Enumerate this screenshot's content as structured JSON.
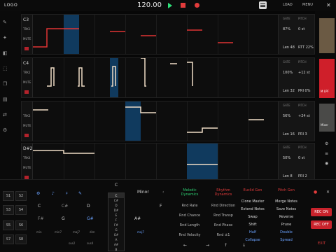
{
  "topbar": {
    "logo": "LOGO",
    "tempo": "120.00",
    "tab_1": "LOAD",
    "tab_2": "MENU"
  },
  "tracks": [
    {
      "note": "C3",
      "label_top": "TRK1",
      "label_mid": "MUTE",
      "param_1": "87%",
      "param_1_label": "GATE",
      "param_2": "0 st",
      "param_2_label": "PITCH",
      "param_3": "Len 48",
      "param_4": "RTT 22%"
    },
    {
      "note": "C4",
      "label_top": "TRK2",
      "label_mid": "MUTE",
      "param_1": "100%",
      "param_1_label": "GATE",
      "param_2": "+12 st",
      "param_2_label": "PITCH",
      "param_3": "Len 32",
      "param_4": "PRI 0%"
    },
    {
      "note": "",
      "label_top": "TRK3",
      "label_mid": "MUTE",
      "param_1": "56%",
      "param_1_label": "GATE",
      "param_2": "+24 st",
      "param_2_label": "PITCH",
      "param_3": "Len 16",
      "param_4": "PRI 3"
    },
    {
      "note": "D#2",
      "label_top": "TRK4",
      "label_mid": "MUTE",
      "param_1": "50%",
      "param_1_label": "GATE",
      "param_2": "0 st",
      "param_2_label": "PITCH",
      "param_3": "Len 8",
      "param_4": "PRI 2"
    }
  ],
  "sidebar": {
    "gain_label": "M LPF",
    "mix_label": "Mixer"
  },
  "pads": [
    "S1",
    "S2",
    "S3",
    "S4",
    "S5",
    "S6",
    "S7",
    "S8",
    "S9",
    "S10"
  ],
  "keys": {
    "row1": [
      "C",
      "C#",
      "D"
    ],
    "row2": [
      "F#",
      "G",
      "G#"
    ],
    "row3": [
      "min",
      "min7",
      "maj7",
      "dim",
      "sus2",
      "sus4"
    ]
  },
  "scale": {
    "root": "C",
    "mode": "Minor",
    "notes": [
      "C",
      "C#",
      "D",
      "D#",
      "E",
      "F",
      "F#",
      "G",
      "G#",
      "A",
      "A#",
      "B"
    ],
    "extra_left": "A#",
    "extra_right": "F",
    "bottom_label": "maj7"
  },
  "mod_menu": {
    "col1": [
      "Melodic Dynamics",
      "Rnd Rate",
      "Rnd Chance",
      "Rnd Length",
      "Rnd Velocity"
    ],
    "col2": [
      "Rhythm Dynamics",
      "Rnd Direction",
      "Rnd Transp",
      "Rnd Phase",
      "Rnd ±1"
    ],
    "col3": [
      "Euclid Gen",
      "Clone Master",
      "Extend Notes",
      "Swap",
      "Shift",
      "Half",
      "Collapse"
    ],
    "col4": [
      "Pitch Gen",
      "Merge Notes",
      "Save Notes",
      "Reverse",
      "Prune",
      "Double",
      "Spread"
    ]
  },
  "record": {
    "rec_on": "REC ON",
    "rec_off": "REC OFF",
    "bottom_right": "EXIT"
  },
  "colors": {
    "accent": "#e23b3b",
    "note_track1": "#e03434",
    "note_track": "#f0ddc6",
    "highlight": "#103a5e",
    "play": "#2ee27a"
  }
}
